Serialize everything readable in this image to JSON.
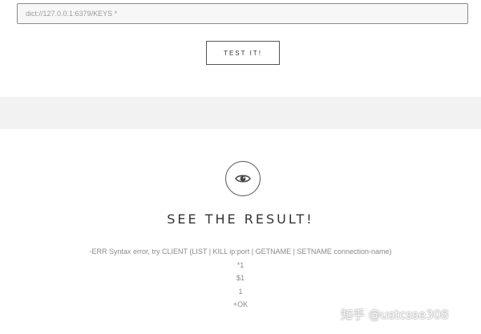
{
  "form": {
    "url_value": "dict://127.0.0.1:6379/KEYS *",
    "test_button_label": "TEST IT!"
  },
  "result": {
    "icon": "eye-icon",
    "title": "SEE THE RESULT!",
    "lines": [
      "-ERR Syntax error, try CLIENT (LIST | KILL ip:port | GETNAME | SETNAME connection-name)",
      "*1",
      "$1",
      "1",
      "+OK"
    ]
  },
  "watermark": {
    "text": "知乎 @ustcsse308"
  },
  "colors": {
    "band": "#f2f2f2",
    "border": "#555555",
    "result_text": "#8a8a8a"
  }
}
